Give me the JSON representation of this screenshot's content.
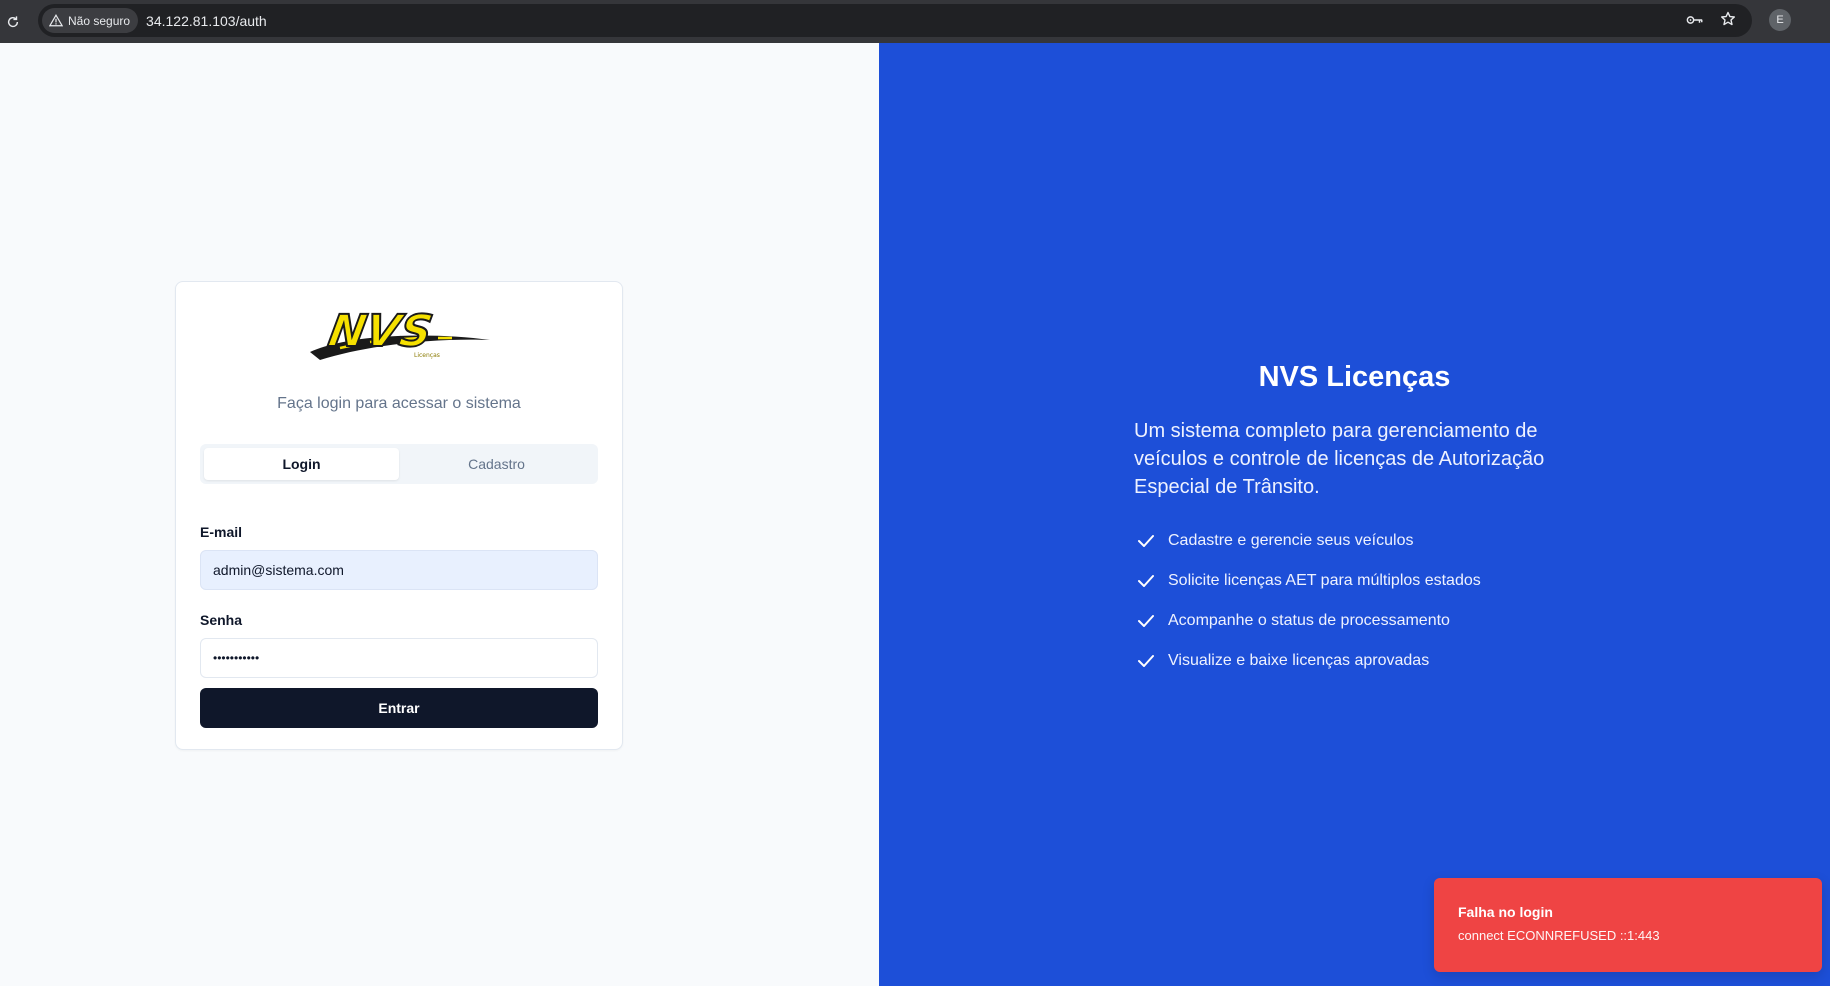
{
  "browser": {
    "security_label": "Não seguro",
    "url": "34.122.81.103/auth",
    "profile_initial": "E",
    "icons": [
      "reload-icon",
      "warning-icon",
      "key-icon",
      "star-icon"
    ]
  },
  "login_card": {
    "logo_text": "NVS",
    "logo_subtext": "Licenças",
    "subtitle": "Faça login para acessar o sistema",
    "tabs": [
      {
        "label": "Login",
        "active": true
      },
      {
        "label": "Cadastro",
        "active": false
      }
    ],
    "email_label": "E-mail",
    "email_value": "admin@sistema.com",
    "password_label": "Senha",
    "password_value": "•••••••••••",
    "submit_label": "Entrar"
  },
  "hero": {
    "title": "NVS Licenças",
    "description": "Um sistema completo para gerenciamento de veículos e controle de licenças de Autorização Especial de Trânsito.",
    "features": [
      "Cadastre e gerencie seus veículos",
      "Solicite licenças AET para múltiplos estados",
      "Acompanhe o status de processamento",
      "Visualize e baixe licenças aprovadas"
    ]
  },
  "toast": {
    "title": "Falha no login",
    "message": "connect ECONNREFUSED ::1:443"
  },
  "colors": {
    "hero_bg": "#1d4fd8",
    "button_bg": "#0f172a",
    "toast_bg": "#ef4444",
    "logo_yellow": "#f5e000"
  }
}
